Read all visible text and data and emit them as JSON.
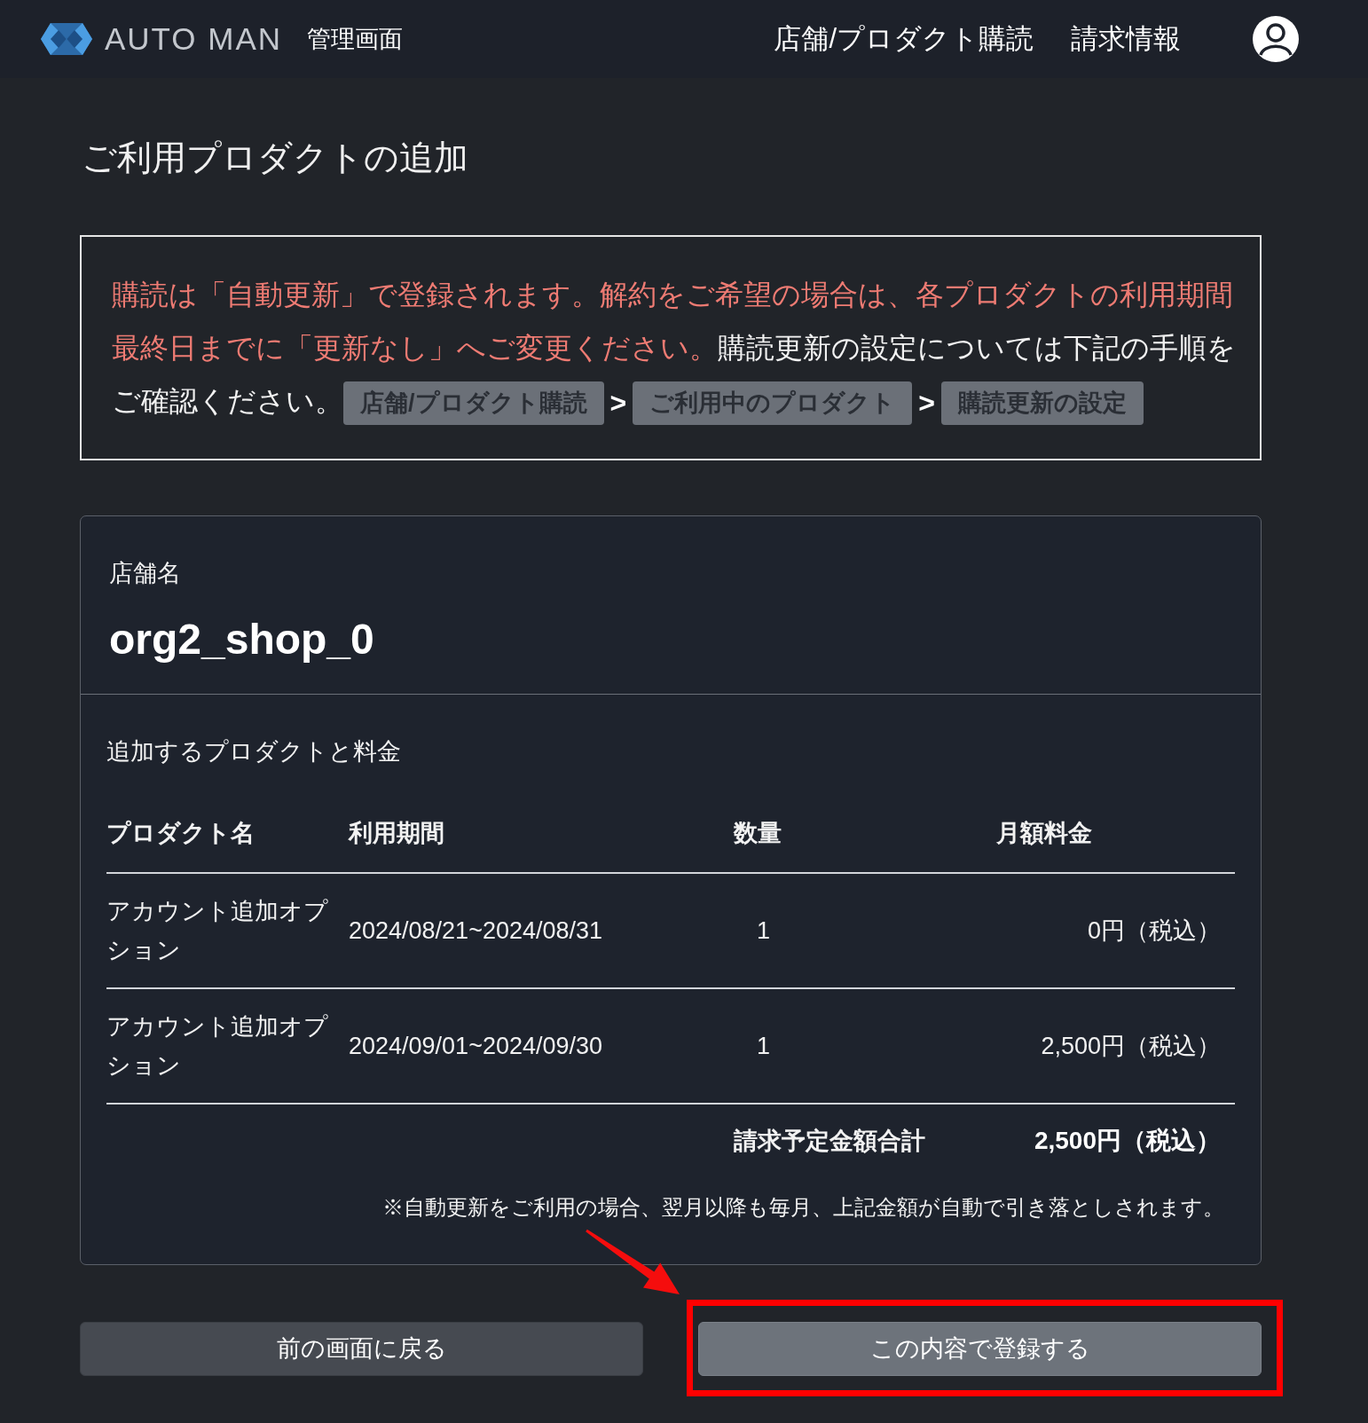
{
  "header": {
    "logo_text": "AUTO MAN",
    "subtitle": "管理画面",
    "nav": [
      {
        "label": "店舗/プロダクト購読"
      },
      {
        "label": "請求情報"
      }
    ]
  },
  "page_title": "ご利用プロダクトの追加",
  "notice": {
    "lines": [
      [
        {
          "kind": "warning",
          "text": "購読は「自動更新」で登録されます。解約をご希望の場合は、各プロダクトの利用期間"
        }
      ],
      [
        {
          "kind": "warning",
          "text": "最終日までに「更新なし」へご変更ください。"
        },
        {
          "kind": "normal",
          "text": "購読更新の設定については下記の手順を"
        }
      ],
      [
        {
          "kind": "normal",
          "text": "ご確認ください。"
        }
      ]
    ],
    "steps": [
      "店舗/プロダクト購読",
      "ご利用中のプロダクト",
      "購読更新の設定"
    ],
    "separators": [
      ">",
      ">"
    ]
  },
  "shop": {
    "label": "店舗名",
    "value": "org2_shop_0"
  },
  "products": {
    "title": "追加するプロダクトと料金",
    "columns": [
      "プロダクト名",
      "利用期間",
      "数量",
      "月額料金"
    ],
    "rows": [
      {
        "product": "アカウント追加オプション",
        "period": "2024/08/21~2024/08/31",
        "quantity": "1",
        "monthly_fee": "0円（税込）"
      },
      {
        "product": "アカウント追加オプション",
        "period": "2024/09/01~2024/09/30",
        "quantity": "1",
        "monthly_fee": "2,500円（税込）"
      }
    ],
    "total": {
      "label": "請求予定金額合計",
      "value": "2,500円（税込）"
    },
    "note": "※自動更新をご利用の場合、翌月以降も毎月、上記金額が自動で引き落としされます。"
  },
  "buttons": [
    {
      "kind": "secondary",
      "label": "前の画面に戻る",
      "highlighted": false
    },
    {
      "kind": "primary",
      "label": "この内容で登録する",
      "highlighted": true
    }
  ]
}
